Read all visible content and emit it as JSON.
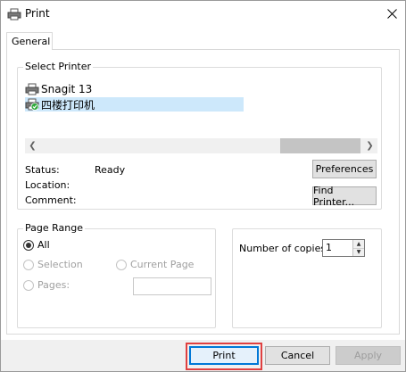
{
  "window": {
    "title": "Print"
  },
  "tabs": [
    {
      "label": "General"
    }
  ],
  "select_printer": {
    "group_label": "Select Printer",
    "printers": [
      {
        "name": "Snagit 13",
        "icon": "printer-icon",
        "selected": false
      },
      {
        "name": "四楼打印机",
        "icon": "default-printer-icon",
        "selected": true
      }
    ]
  },
  "printer_info": {
    "status_label": "Status:",
    "status_value": "Ready",
    "location_label": "Location:",
    "location_value": "",
    "comment_label": "Comment:",
    "comment_value": ""
  },
  "buttons": {
    "preferences": "Preferences",
    "find_printer": "Find Printer...",
    "print": "Print",
    "cancel": "Cancel",
    "apply": "Apply"
  },
  "page_range": {
    "group_label": "Page Range",
    "options": {
      "all": "All",
      "selection": "Selection",
      "current_page": "Current Page",
      "pages": "Pages:"
    },
    "selected": "all",
    "pages_value": ""
  },
  "copies": {
    "label": "Number of copies:",
    "value": "1"
  },
  "colors": {
    "highlight": "#e04040",
    "selected_item": "#cde8fb",
    "default_green": "#2eaa3a"
  }
}
